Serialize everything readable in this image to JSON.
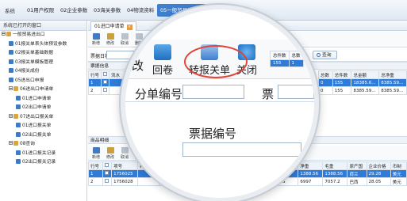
{
  "topbar": {
    "system_label": "系统",
    "tabs": [
      "01用户权限",
      "02企业参数",
      "03海关参数",
      "04物流资料",
      "05一般贸易进出口"
    ],
    "active_tab_index": 4
  },
  "left": {
    "header": "系统已打开的窗口",
    "tree": [
      {
        "label": "一般贸易进出口",
        "level": 0,
        "type": "root"
      },
      {
        "label": "01报关单表头体预设参数",
        "level": 1,
        "type": "doc"
      },
      {
        "label": "02报关单基础数据",
        "level": 1,
        "type": "doc"
      },
      {
        "label": "03报关单模板管理",
        "level": 1,
        "type": "doc"
      },
      {
        "label": "04报关成份",
        "level": 1,
        "type": "doc"
      },
      {
        "label": "05进出口申报",
        "level": 1,
        "type": "doc"
      },
      {
        "label": "06进出口申请单",
        "level": 1,
        "type": "folder"
      },
      {
        "label": "01进口申请单",
        "level": 2,
        "type": "doc"
      },
      {
        "label": "02出口申请单",
        "level": 2,
        "type": "doc"
      },
      {
        "label": "07进出口报关单",
        "level": 1,
        "type": "folder"
      },
      {
        "label": "01进口报关单",
        "level": 2,
        "type": "doc"
      },
      {
        "label": "02出口报关单",
        "level": 2,
        "type": "doc"
      },
      {
        "label": "08查询",
        "level": 1,
        "type": "folder"
      },
      {
        "label": "01进口报关记录",
        "level": 2,
        "type": "doc"
      },
      {
        "label": "02出口报关记录",
        "level": 2,
        "type": "doc"
      }
    ]
  },
  "window_tab": "01进口申请单",
  "toolbar": [
    "新增",
    "修改",
    "取消",
    "删除"
  ],
  "filter": {
    "label": "票据日期",
    "query": "查询"
  },
  "sections": {
    "header": "票据信息",
    "detail": "商品明细"
  },
  "top_grid": {
    "columns": [
      "行号",
      "",
      "流水"
    ],
    "rows": [
      [
        "1",
        ""
      ],
      [
        "2",
        ""
      ]
    ]
  },
  "right_top_grid": {
    "columns": [
      "总数",
      "总件数",
      "总金额",
      "总净重"
    ],
    "rows": [
      [
        "0",
        "155",
        "18385.6...",
        "8385.59..."
      ],
      [
        "0",
        "155",
        "8385.59...",
        "8385.59..."
      ]
    ]
  },
  "bottom_toolbar": [
    "新增",
    "修改",
    "取消",
    "删除",
    "保存"
  ],
  "bottom_grid": {
    "columns": [
      "行号",
      "",
      "项号",
      "料号",
      "品名",
      "规格",
      "件数",
      "包装种类",
      "箱号",
      "企业数量",
      "企业单位",
      "净重",
      "毛重",
      "原产国",
      "企业价格",
      "币制"
    ],
    "rows": [
      [
        "1",
        "",
        "1756025",
        "",
        "",
        "",
        "11",
        "纸箱",
        "1-11",
        "1388.56",
        "KGS",
        "1388.56",
        "1388.56",
        "荷兰",
        "29.28",
        "美元"
      ],
      [
        "2",
        "",
        "1756028",
        "",
        "",
        "",
        "144",
        "纸箱",
        "1-144",
        "6997",
        "KGS",
        "6997",
        "7057.2",
        "巴西",
        "28.05",
        "美元"
      ]
    ]
  },
  "magnifier": {
    "buttons": [
      "回卷",
      "转报关单",
      "关闭"
    ],
    "partial_left": "改",
    "field1": "分单编号",
    "field2_partial": "票",
    "field3": "票据编号",
    "query": "查询",
    "mini_cols": [
      "总件数",
      "总数"
    ],
    "mini_vals": [
      "155",
      "1"
    ]
  },
  "colors": {
    "accent": "#2f7bd8",
    "ring": "#e0443a"
  }
}
